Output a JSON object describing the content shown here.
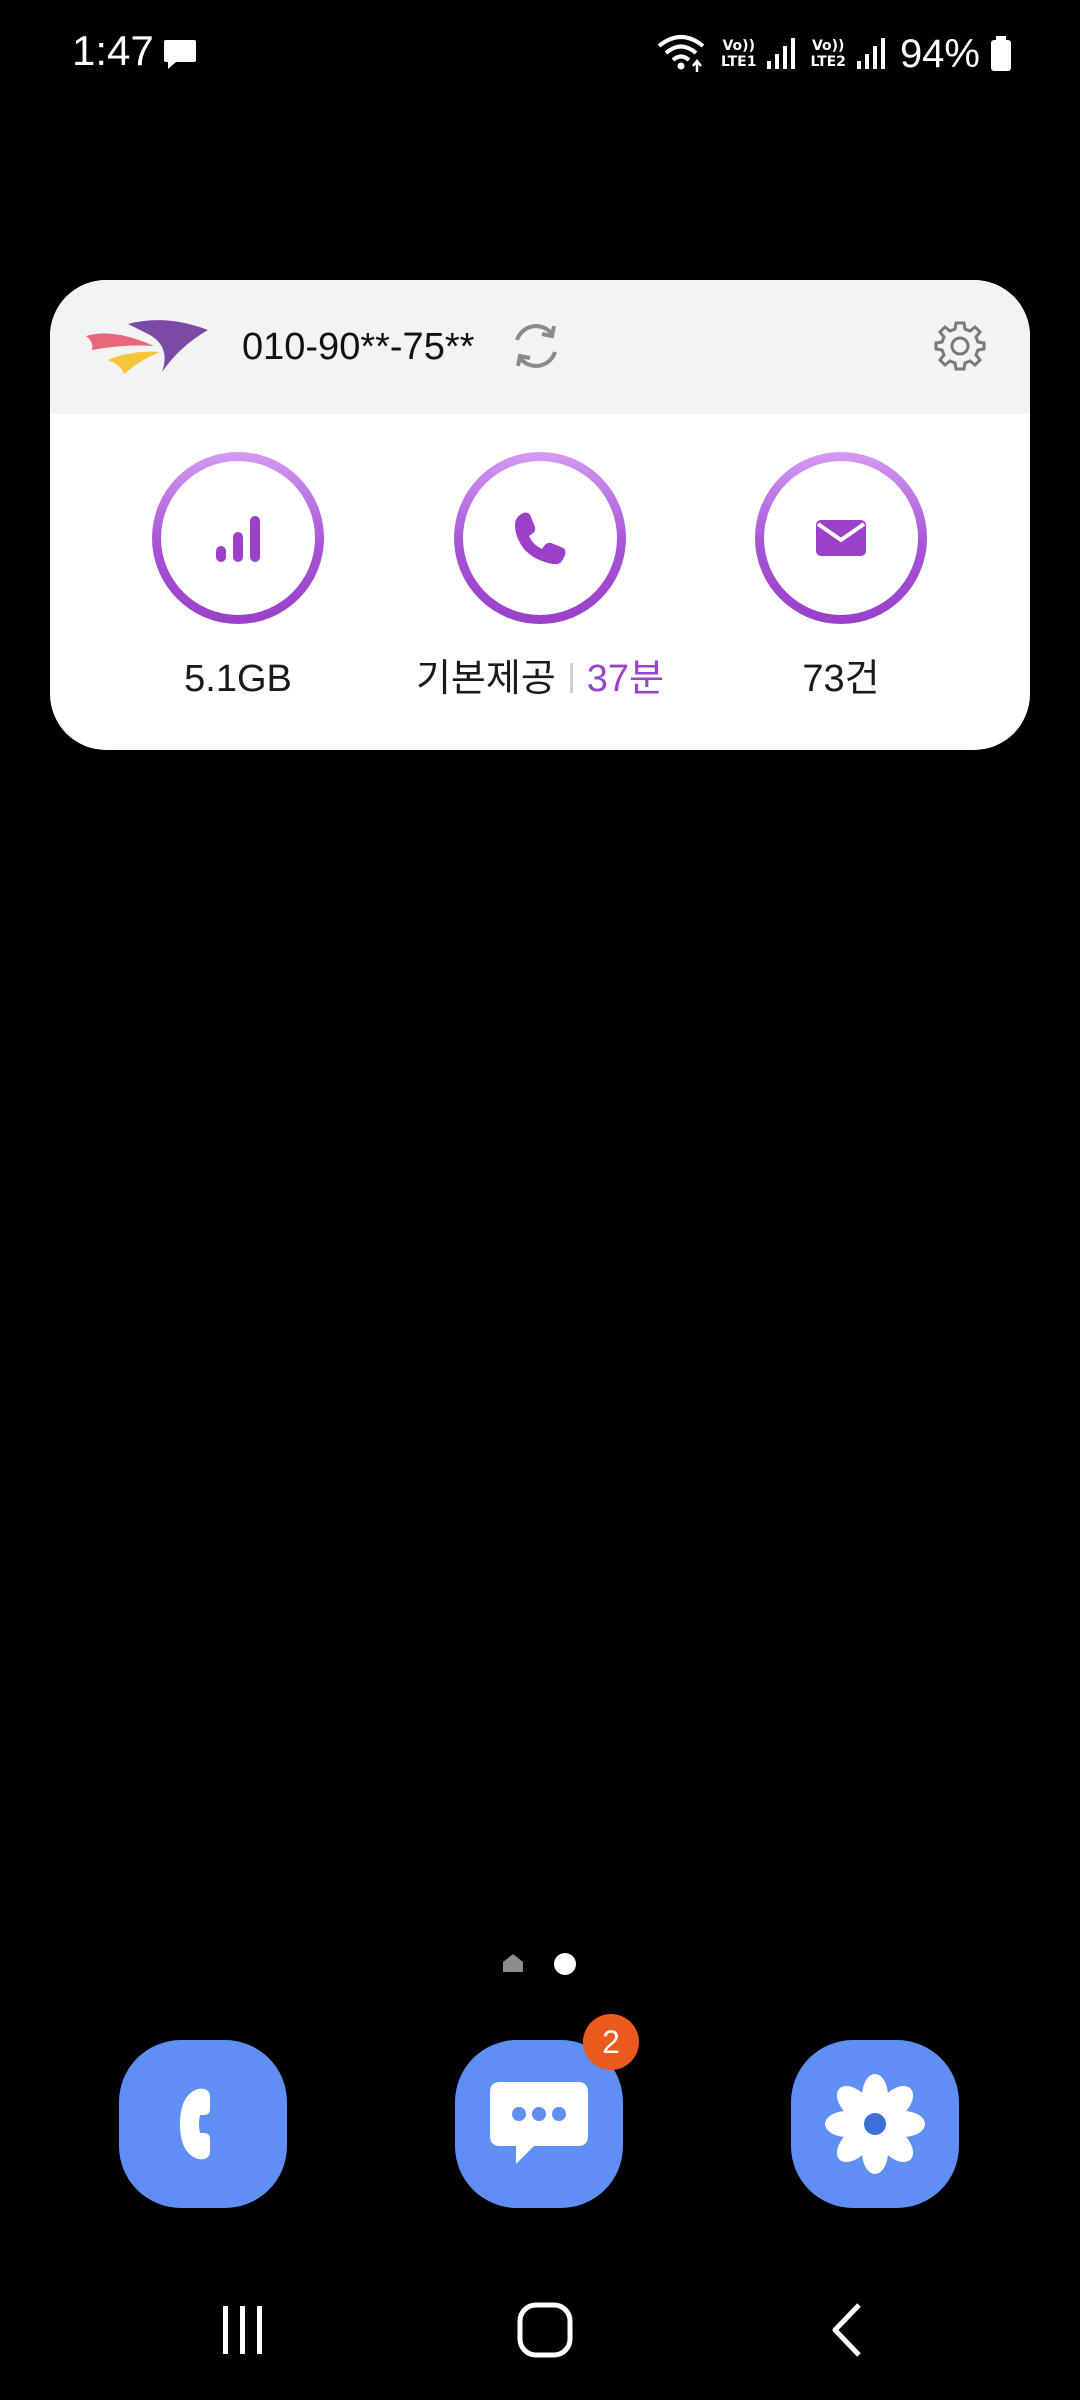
{
  "status_bar": {
    "time": "1:47",
    "battery_percent": "94%",
    "notification_icons": [
      "message-icon"
    ],
    "sim1_label": "LTE1",
    "sim2_label": "LTE2",
    "volte_label": "Vo))",
    "wifi": true
  },
  "widget": {
    "phone_number": "010-90**-75**",
    "stats": [
      {
        "icon": "signal-bars-icon",
        "label": "5.1GB"
      },
      {
        "icon": "phone-icon",
        "label": "기본제공",
        "value": "37분"
      },
      {
        "icon": "envelope-icon",
        "label": "73건"
      }
    ],
    "colors": {
      "accent": "#9a45c9",
      "header_bg": "#f3f3f3"
    }
  },
  "home": {
    "page_count": 2,
    "current_page": 2
  },
  "dock": {
    "apps": [
      {
        "name": "phone-app",
        "icon": "phone-icon",
        "badge": ""
      },
      {
        "name": "messages-app",
        "icon": "chat-bubble-icon",
        "badge": "2"
      },
      {
        "name": "gallery-app",
        "icon": "flower-icon",
        "badge": ""
      }
    ],
    "icon_color": "#5f8ff2",
    "badge_color": "#ea5a1f"
  },
  "nav_bar": {
    "buttons": [
      "recent-apps",
      "home",
      "back"
    ]
  }
}
